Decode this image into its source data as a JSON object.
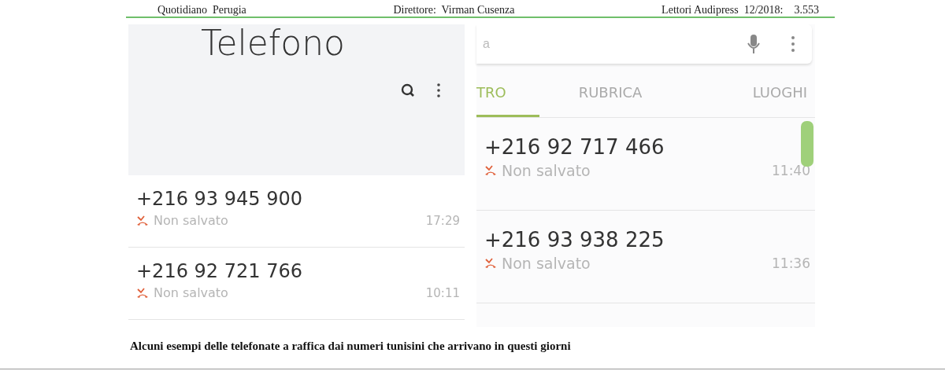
{
  "masthead": [
    "Quotidiano  Perugia",
    "Direttore:  Virman Cusenza",
    "Lettori Audipress  12/2018:    3.553"
  ],
  "left_screen": {
    "title": "Telefono",
    "calls": [
      {
        "number": "+216 93 945 900",
        "status": "Non salvato",
        "time": "17:29"
      },
      {
        "number": "+216 92 721 766",
        "status": "Non salvato",
        "time": "10:11"
      }
    ]
  },
  "right_screen": {
    "search": {
      "placeholder": "a"
    },
    "tabs": [
      {
        "label": "TRO",
        "selected": true
      },
      {
        "label": "RUBRICA",
        "selected": false
      },
      {
        "label": "LUOGHI",
        "selected": false
      }
    ],
    "calls": [
      {
        "number": "+216 92 717 466",
        "status": "Non salvato",
        "time": "11:40"
      },
      {
        "number": "+216 93 938 225",
        "status": "Non salvato",
        "time": "11:36"
      }
    ]
  },
  "caption": "Alcuni esempi delle telefonate a raffica dai numeri tunisini che arrivano in questi giorni"
}
